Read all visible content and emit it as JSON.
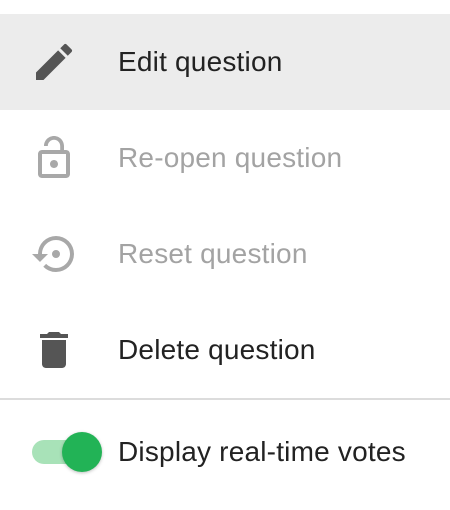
{
  "menu": {
    "items": [
      {
        "label": "Edit question",
        "icon": "pencil-icon",
        "state": "enabled",
        "highlighted": true
      },
      {
        "label": "Re-open question",
        "icon": "lock-open-icon",
        "state": "disabled",
        "highlighted": false
      },
      {
        "label": "Reset question",
        "icon": "restore-icon",
        "state": "disabled",
        "highlighted": false
      },
      {
        "label": "Delete question",
        "icon": "trash-icon",
        "state": "enabled",
        "highlighted": false
      }
    ],
    "toggle": {
      "label": "Display real-time votes",
      "checked": true
    }
  },
  "colors": {
    "highlight_bg": "#ececec",
    "enabled_text": "#222222",
    "disabled_text": "#a3a3a3",
    "enabled_icon": "#555555",
    "disabled_icon": "#a8a8a8",
    "toggle_thumb": "#22b356",
    "toggle_track": "#a8e2b8",
    "divider": "#dcdcdc"
  }
}
